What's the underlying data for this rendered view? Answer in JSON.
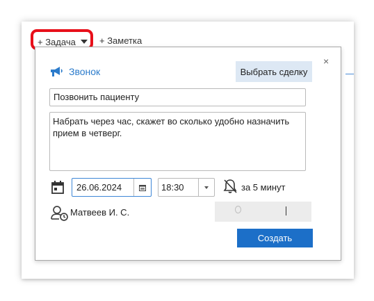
{
  "toolbar": {
    "task_label": "+ Задача",
    "note_label": "+ Заметка"
  },
  "popup": {
    "close_symbol": "×",
    "type_label": "Звонок",
    "deal_button_label": "Выбрать сделку",
    "title_value": "Позвонить пациенту",
    "description_value": "Набрать через час, скажет во сколько удобно назначить прием в четверг.",
    "date_value": "26.06.2024",
    "time_value": "18:30",
    "reminder_label": "за 5 минут",
    "assignee_name": "Матвеев И. С.",
    "create_button_label": "Создать"
  },
  "colors": {
    "accent_blue": "#2b7bcb",
    "primary_button": "#1c6fc8",
    "highlight_red": "#e8101a",
    "deal_button_bg": "#dde8f4"
  },
  "icons": {
    "type": "megaphone-icon",
    "date": "calendar-icon",
    "date_picker": "calendar-small-icon",
    "time_dropdown": "caret-down-icon",
    "reminder": "bell-off-icon",
    "assignee": "user-clock-icon"
  }
}
